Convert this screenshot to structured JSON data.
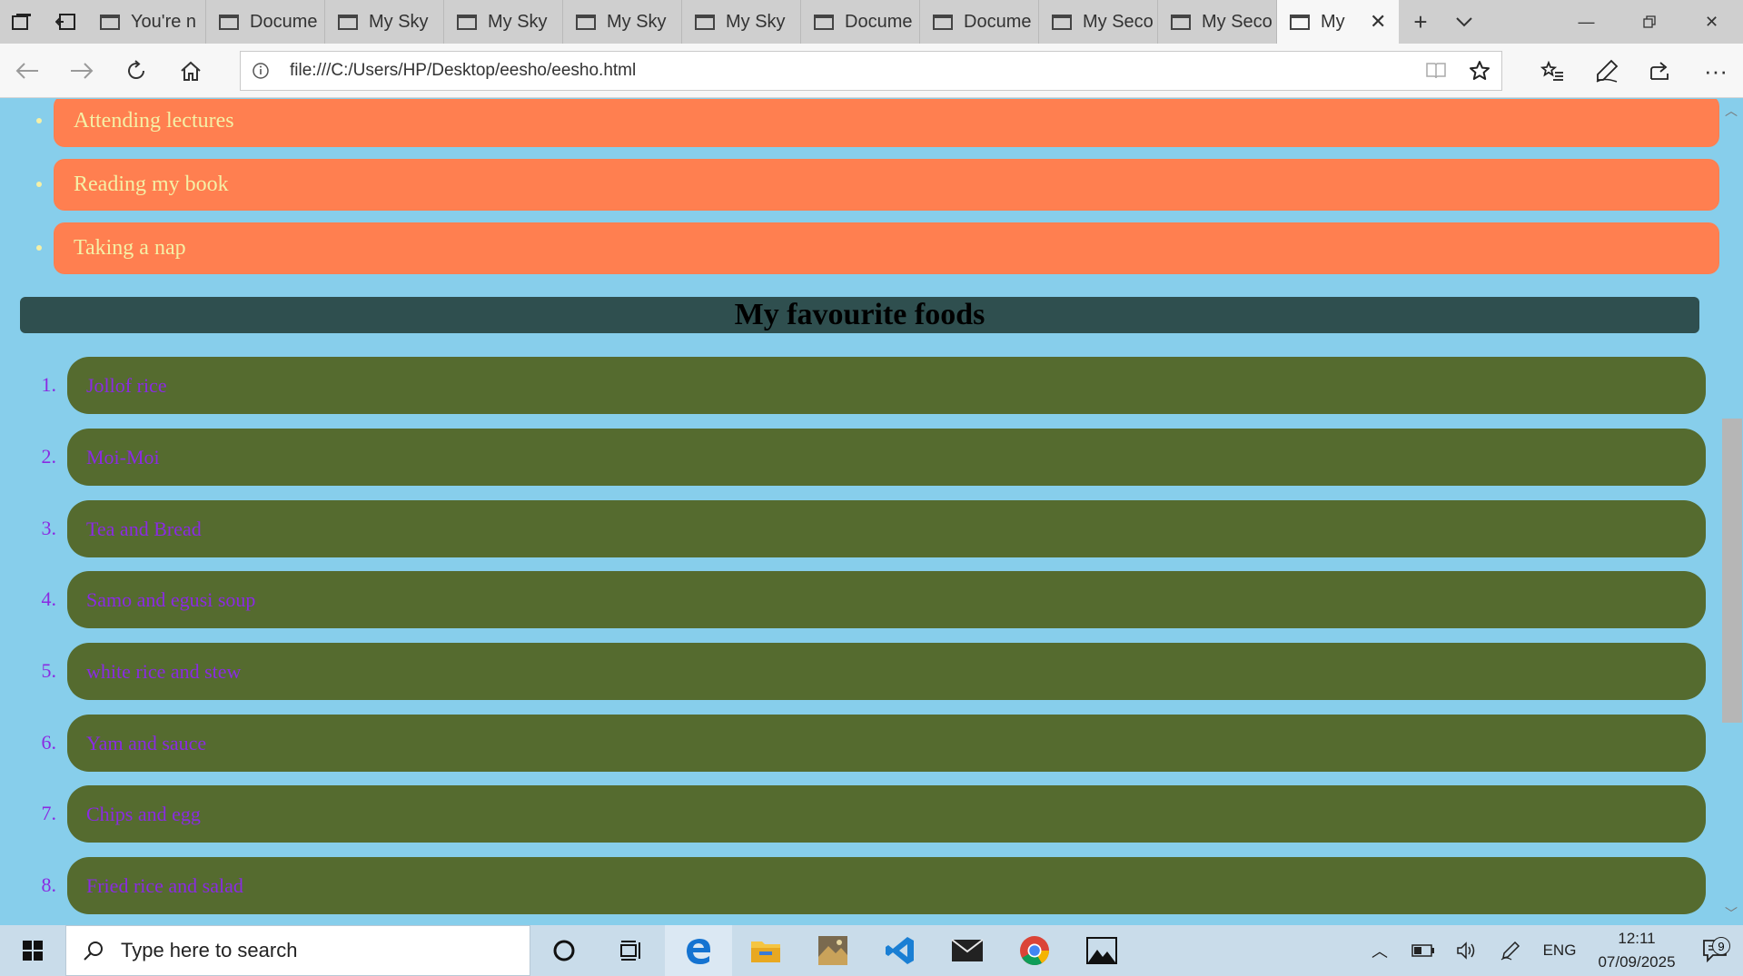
{
  "browser": {
    "tabs": [
      {
        "label": "You're n"
      },
      {
        "label": "Docume"
      },
      {
        "label": "My Sky"
      },
      {
        "label": "My Sky"
      },
      {
        "label": "My Sky"
      },
      {
        "label": "My Sky"
      },
      {
        "label": "Docume"
      },
      {
        "label": "Docume"
      },
      {
        "label": "My Seco"
      },
      {
        "label": "My Seco"
      },
      {
        "label": "My"
      }
    ],
    "active_tab_index": 10,
    "address": "file:///C:/Users/HP/Desktop/eesho/eesho.html"
  },
  "page": {
    "hobbies": [
      "Attending lectures",
      "Reading my book",
      "Taking a nap"
    ],
    "foods_heading": "My favourite foods",
    "foods": [
      {
        "num": "1.",
        "label": "Jollof rice"
      },
      {
        "num": "2.",
        "label": "Moi-Moi"
      },
      {
        "num": "3.",
        "label": "Tea and Bread"
      },
      {
        "num": "4.",
        "label": "Samo and egusi soup"
      },
      {
        "num": "5.",
        "label": "white rice and stew"
      },
      {
        "num": "6.",
        "label": "Yam and sauce"
      },
      {
        "num": "7.",
        "label": "Chips and egg"
      },
      {
        "num": "8.",
        "label": "Fried rice and salad"
      }
    ]
  },
  "taskbar": {
    "search_placeholder": "Type here to search",
    "language": "ENG",
    "time": "12:11",
    "date": "07/09/2025",
    "notification_count": "9"
  },
  "colors": {
    "page_background": "#87ceeb",
    "hobby_background": "#ff7f50",
    "hobby_text": "#f5f0a6",
    "heading_background": "#2f4f4f",
    "food_background": "#556b2f",
    "food_text": "#8a2be2"
  }
}
